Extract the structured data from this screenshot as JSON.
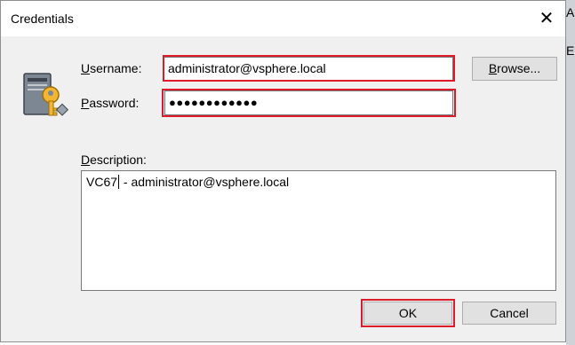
{
  "window": {
    "title": "Credentials",
    "close_glyph": "✕"
  },
  "background_strip": {
    "letters": [
      "A",
      "E"
    ]
  },
  "username": {
    "label_key": "U",
    "label_rest": "sername:",
    "value": "administrator@vsphere.local"
  },
  "password": {
    "label_key": "P",
    "label_rest": "assword:",
    "value": "●●●●●●●●●●●●"
  },
  "browse": {
    "label_key": "B",
    "label_rest": "rowse..."
  },
  "description": {
    "label_key": "D",
    "label_rest": "escription:",
    "text_before_caret": "VC67",
    "text_after_caret": " - administrator@vsphere.local"
  },
  "buttons": {
    "ok_label": "OK",
    "cancel_label": "Cancel"
  },
  "icons": {
    "credentials_icon": "server-key-icon",
    "close_icon": "close-icon"
  },
  "colors": {
    "highlight": "#dd1c2a",
    "dialog_bg": "#f0f0f0",
    "button_bg": "#e1e1e1"
  }
}
